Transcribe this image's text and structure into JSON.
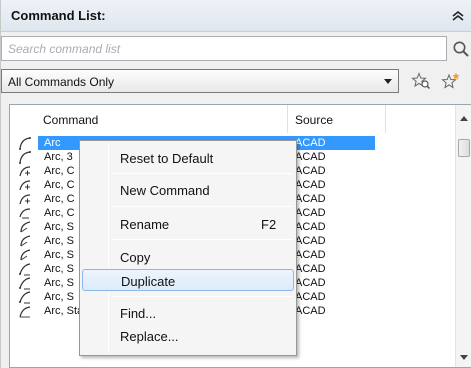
{
  "panel": {
    "title": "Command List:"
  },
  "search": {
    "placeholder": "Search command list",
    "value": ""
  },
  "filter": {
    "selected": "All Commands Only"
  },
  "list": {
    "columns": [
      "Command",
      "Source"
    ],
    "rows": [
      {
        "name": "Arc",
        "source": "ACAD",
        "selected": true,
        "icon": "arc-3point-icon"
      },
      {
        "name": "Arc, 3",
        "source": "ACAD",
        "icon": "arc-3point-icon"
      },
      {
        "name": "Arc, C",
        "source": "ACAD",
        "icon": "arc-center-start-icon"
      },
      {
        "name": "Arc, C",
        "source": "ACAD",
        "icon": "arc-center-start-icon"
      },
      {
        "name": "Arc, C",
        "source": "ACAD",
        "icon": "arc-center-start-icon"
      },
      {
        "name": "Arc, C",
        "source": "ACAD",
        "icon": "arc-continue-icon"
      },
      {
        "name": "Arc, S",
        "source": "ACAD",
        "icon": "arc-start-center-icon"
      },
      {
        "name": "Arc, S",
        "source": "ACAD",
        "icon": "arc-start-center-icon"
      },
      {
        "name": "Arc, S",
        "source": "ACAD",
        "icon": "arc-start-center-icon"
      },
      {
        "name": "Arc, S",
        "source": "ACAD",
        "icon": "arc-start-end-icon"
      },
      {
        "name": "Arc, S",
        "source": "ACAD",
        "icon": "arc-start-end-icon"
      },
      {
        "name": "Arc, S",
        "source": "ACAD",
        "icon": "arc-start-end-icon"
      },
      {
        "name": "Arc, Start, End, Radius",
        "source": "ACAD",
        "icon": "arc-start-end-radius-icon"
      }
    ]
  },
  "context_menu": {
    "items": [
      {
        "label": "Reset to Default",
        "shortcut": ""
      },
      {
        "label": "New Command",
        "shortcut": ""
      },
      {
        "label": "Rename",
        "shortcut": "F2"
      },
      {
        "label": "Copy",
        "shortcut": ""
      },
      {
        "label": "Duplicate",
        "shortcut": "",
        "hover": true
      },
      {
        "label": "Find...",
        "shortcut": ""
      },
      {
        "label": "Replace...",
        "shortcut": ""
      }
    ]
  },
  "colors": {
    "selection": "#3399ff",
    "menu_hover_border": "#8cb7e6",
    "accent_star": "#f0a030"
  }
}
